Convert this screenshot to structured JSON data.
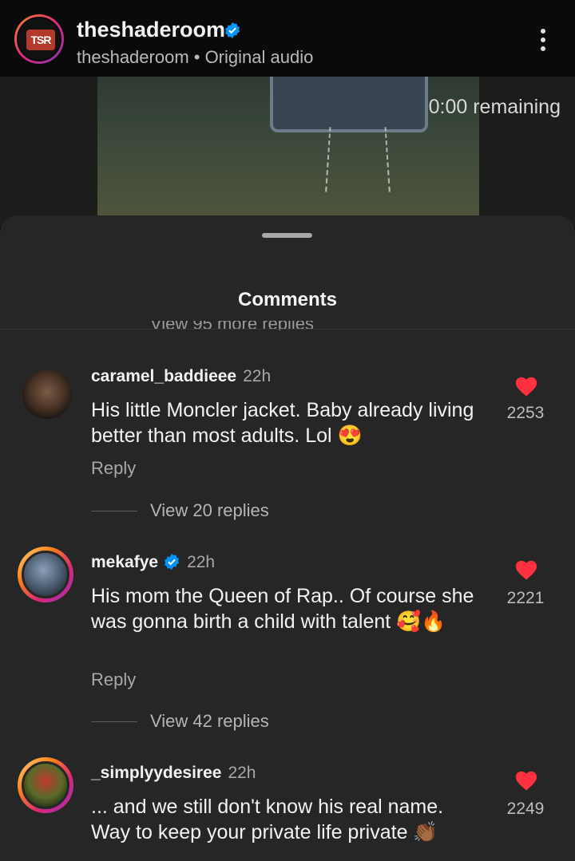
{
  "header": {
    "account_name": "theshaderoom",
    "subline": "theshaderoom • Original audio",
    "logo_text": "TSR"
  },
  "video": {
    "remaining": "0:00 remaining"
  },
  "sheet": {
    "title": "Comments",
    "partial_text": "View 95 more replies"
  },
  "colors": {
    "like_red": "#ff3040",
    "verified_blue": "#0095f6",
    "sheet_bg": "#262626"
  },
  "comments": [
    {
      "username": "caramel_baddieee",
      "time": "22h",
      "verified": false,
      "text": "His little Moncler jacket. Baby already living better than most adults. Lol 😍",
      "reply_label": "Reply",
      "view_replies": "View 20 replies",
      "likes": "2253"
    },
    {
      "username": "mekafye",
      "time": "22h",
      "verified": true,
      "text": "His mom the Queen of Rap.. Of course she was gonna birth a child with talent 🥰🔥",
      "reply_label": "Reply",
      "view_replies": "View 42 replies",
      "likes": "2221"
    },
    {
      "username": "_simplyydesiree",
      "time": "22h",
      "verified": false,
      "text": "... and we still don't know his real name. Way to keep your private life private 👏🏾",
      "likes": "2249"
    }
  ]
}
